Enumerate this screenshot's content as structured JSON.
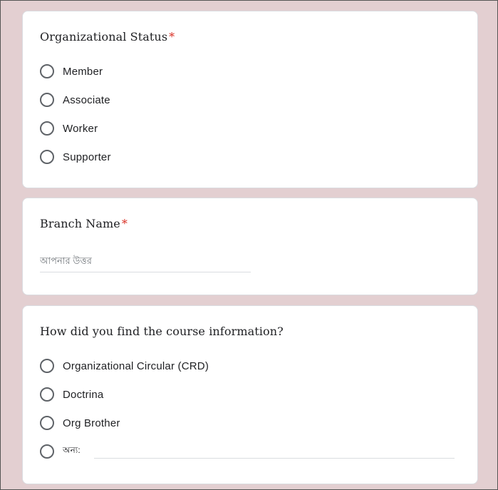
{
  "org_status": {
    "title": "Organizational Status",
    "required_mark": "*",
    "options": [
      "Member",
      "Associate",
      "Worker",
      "Supporter"
    ]
  },
  "branch": {
    "title": "Branch Name",
    "required_mark": "*",
    "placeholder": "আপনার উত্তর"
  },
  "course_info": {
    "title": "How did you find the course information?",
    "options": [
      "Organizational Circular (CRD)",
      "Doctrina",
      "Org Brother"
    ],
    "other_label": "অন্য:"
  }
}
